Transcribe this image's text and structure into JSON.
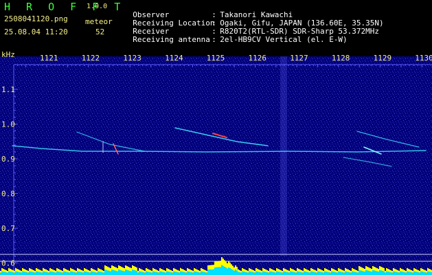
{
  "header": {
    "app_title": "H R O F F T",
    "app_version": "1.0.0",
    "filename": "2508041120.png",
    "datetime": "25.08.04 11:20",
    "meteor_label": "meteor",
    "meteor_count": "52"
  },
  "info": [
    {
      "key": "Observer",
      "value": "Takanori Kawachi"
    },
    {
      "key": "Receiving Location",
      "value": "Ogaki, Gifu, JAPAN (136.60E, 35.35N)"
    },
    {
      "key": "Receiver",
      "value": "R820T2(RTL-SDR) SDR-Sharp 53.372MHz"
    },
    {
      "key": "Receiving antenna",
      "value": "2el-HB9CV Vertical (el. E-W)"
    }
  ],
  "axis": {
    "y_unit": "kHz",
    "x_ticks": [
      "1121",
      "1122",
      "1123",
      "1124",
      "1125",
      "1126",
      "1127",
      "1128",
      "1129",
      "1130"
    ],
    "y_ticks": [
      "1.1",
      "1.0",
      "0.9",
      "0.8",
      "0.7",
      "0.6"
    ]
  },
  "colors": {
    "background": "#000080",
    "grid": "#5a5aff",
    "label_yellow": "#f6f08a",
    "title_green": "#3cff3c",
    "echo_cyan": "#40e0ff",
    "echo_red": "#ff4040",
    "histogram_yellow": "#ffff00",
    "histogram_cyan": "#00e0ff"
  }
}
